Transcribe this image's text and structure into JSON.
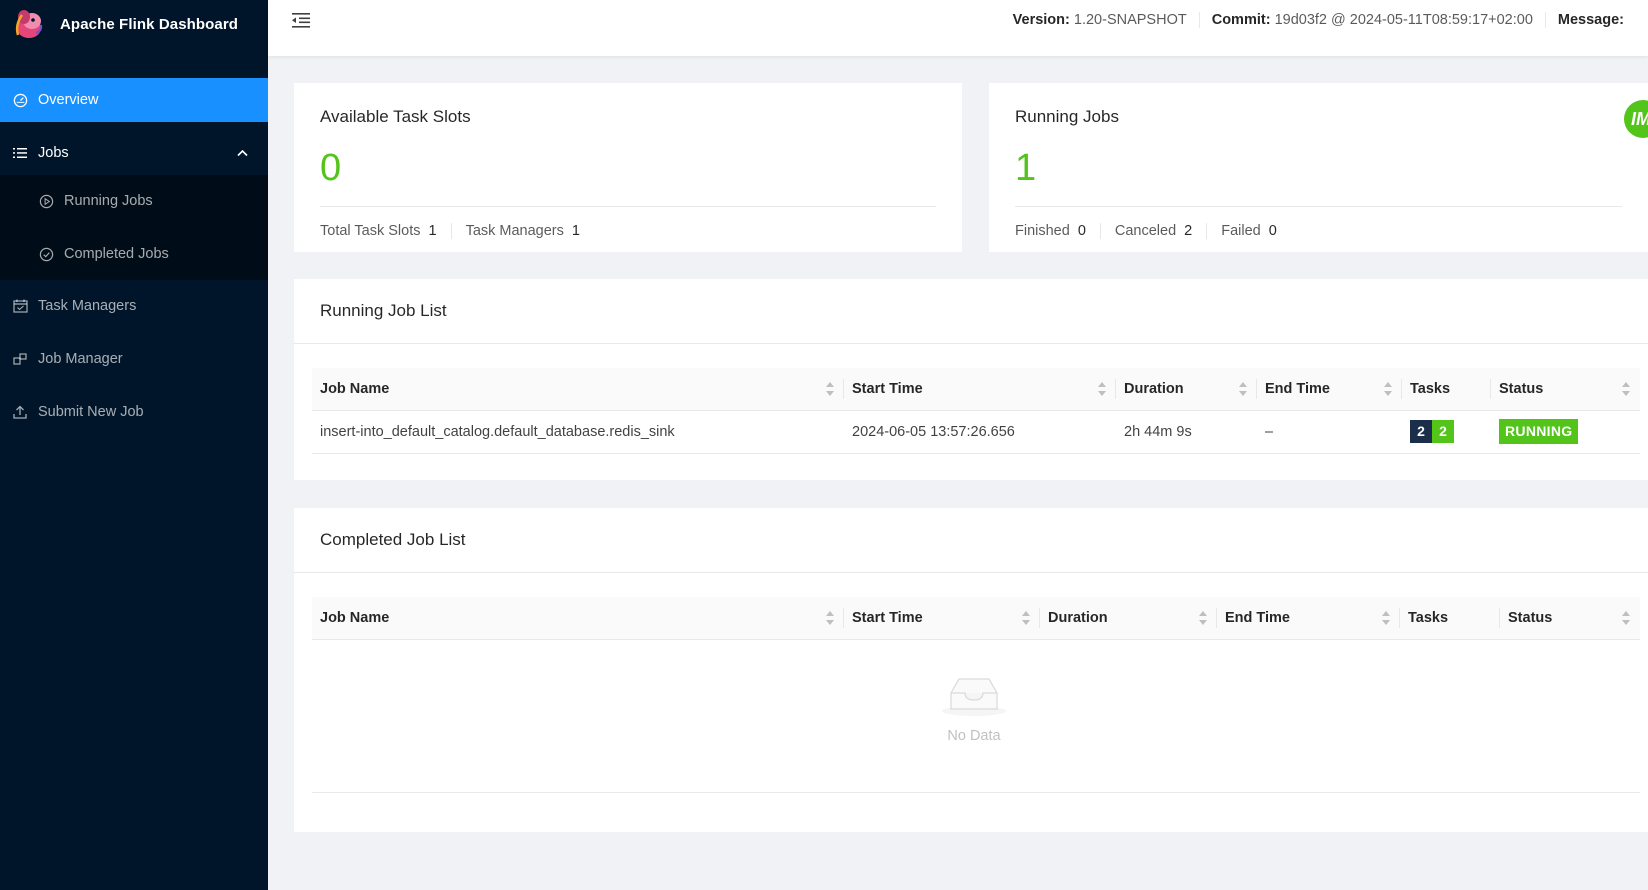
{
  "app": {
    "title": "Apache Flink Dashboard"
  },
  "sidebar": {
    "items": [
      {
        "label": "Overview",
        "icon": "dashboard-icon",
        "active": true
      },
      {
        "label": "Jobs",
        "icon": "list-icon",
        "open": true,
        "children": [
          {
            "label": "Running Jobs",
            "icon": "play-circle-icon"
          },
          {
            "label": "Completed Jobs",
            "icon": "check-circle-icon"
          }
        ]
      },
      {
        "label": "Task Managers",
        "icon": "schedule-icon"
      },
      {
        "label": "Job Manager",
        "icon": "build-icon"
      },
      {
        "label": "Submit New Job",
        "icon": "upload-icon"
      }
    ]
  },
  "header": {
    "version_label": "Version:",
    "version_value": "1.20-SNAPSHOT",
    "commit_label": "Commit:",
    "commit_value": "19d03f2 @ 2024-05-11T08:59:17+02:00",
    "message_label": "Message:"
  },
  "task_slots": {
    "title": "Available Task Slots",
    "value": "0",
    "total_label": "Total Task Slots",
    "total_value": "1",
    "tm_label": "Task Managers",
    "tm_value": "1"
  },
  "running_jobs": {
    "title": "Running Jobs",
    "value": "1",
    "finished_label": "Finished",
    "finished_value": "0",
    "canceled_label": "Canceled",
    "canceled_value": "2",
    "failed_label": "Failed",
    "failed_value": "0",
    "badge": "IM"
  },
  "running_list": {
    "title": "Running Job List",
    "columns": [
      "Job Name",
      "Start Time",
      "Duration",
      "End Time",
      "Tasks",
      "Status"
    ],
    "rows": [
      {
        "job_name": "insert-into_default_catalog.default_database.redis_sink",
        "start_time": "2024-06-05 13:57:26.656",
        "duration": "2h 44m 9s",
        "end_time": "–",
        "tasks_a": "2",
        "tasks_b": "2",
        "status": "RUNNING"
      }
    ]
  },
  "completed_list": {
    "title": "Completed Job List",
    "columns": [
      "Job Name",
      "Start Time",
      "Duration",
      "End Time",
      "Tasks",
      "Status"
    ],
    "empty_text": "No Data"
  },
  "colors": {
    "sidebar": "#001529",
    "active": "#1890ff",
    "success": "#52c41a",
    "task_dark": "#1b2e4a"
  }
}
